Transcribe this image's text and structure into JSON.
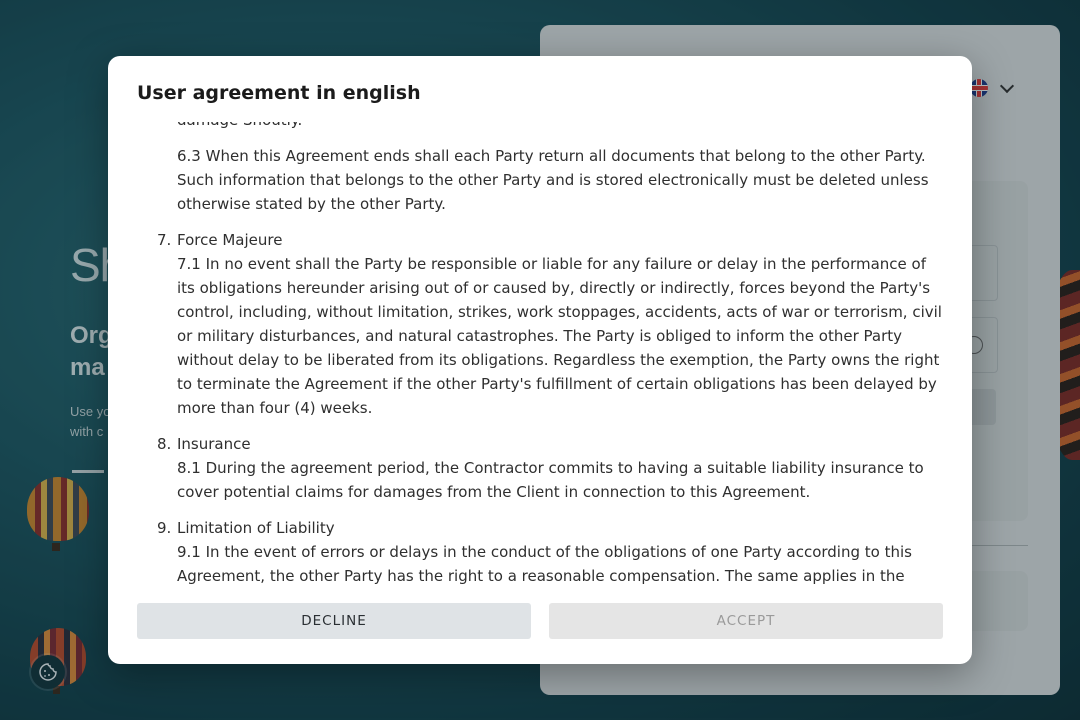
{
  "background": {
    "logo_text": "Sh",
    "hero_title": "Org\nma",
    "hero_subtitle": "Use yo\nwith c"
  },
  "modal": {
    "title": "User agreement in english",
    "paragraphs": [
      "damage Shoutly.",
      "6.3 When this Agreement ends shall each Party return all documents that belong to the other Party. Such information that belongs to the other Party and is stored electronically must be deleted unless otherwise stated by the other Party."
    ],
    "sections": [
      {
        "number": "7.",
        "heading": "Force Majeure",
        "text": "7.1 In no event shall the Party be responsible or liable for any failure or delay in the performance of its obligations hereunder arising out of or caused by, directly or indirectly, forces beyond the Party's control, including, without limitation, strikes, work stoppages, accidents, acts of war or terrorism, civil or military disturbances, and natural catastrophes. The Party is obliged to inform the other Party without delay to be liberated from its obligations. Regardless the exemption, the Party owns the right to terminate the Agreement if the other Party's fulfillment of certain obligations has been delayed by more than four (4) weeks."
      },
      {
        "number": "8.",
        "heading": "Insurance",
        "text": "8.1 During the agreement period, the Contractor commits to having a suitable liability insurance to cover potential claims for damages from the Client in connection to this Agreement."
      },
      {
        "number": "9.",
        "heading": "Limitation of Liability",
        "text": "9.1 In the event of errors or delays in the conduct of the obligations of one Party according to this Agreement, the other Party has the right to a reasonable compensation. The same applies in the"
      }
    ],
    "decline_label": "DECLINE",
    "accept_label": "ACCEPT"
  },
  "icons": {
    "language_flag": "uk-flag-icon",
    "language_dropdown": "chevron-down-icon",
    "cookie": "cookie-icon",
    "password_visibility": "eye-icon"
  },
  "colors": {
    "modal_bg": "#ffffff",
    "decline_bg": "#dfe3e6",
    "accept_bg": "#e5e5e5",
    "accept_text": "#9a9a9a",
    "page_bg": "#1d5560"
  }
}
